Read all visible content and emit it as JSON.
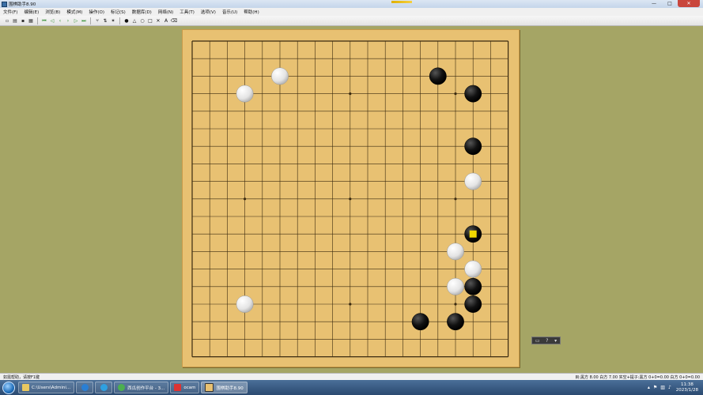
{
  "window": {
    "title": "围棋助手8.90",
    "buttons": {
      "minimize": "—",
      "maximize": "□",
      "close": "✕"
    }
  },
  "menu": [
    "文件(F)",
    "编辑(E)",
    "浏览(B)",
    "模式(M)",
    "操作(O)",
    "标记(S)",
    "数据库(D)",
    "网络(N)",
    "工具(T)",
    "选项(V)",
    "音乐(U)",
    "帮助(H)"
  ],
  "toolbar": [
    {
      "icon": "new-icon",
      "glyph": "▫"
    },
    {
      "icon": "open-icon",
      "glyph": "▤"
    },
    {
      "icon": "save-icon",
      "glyph": "▪"
    },
    {
      "icon": "print-icon",
      "glyph": "▦"
    },
    {
      "icon": "sep"
    },
    {
      "icon": "go-first-icon",
      "glyph": "⏮",
      "c": "green"
    },
    {
      "icon": "step-back-fast-icon",
      "glyph": "◁",
      "c": "green"
    },
    {
      "icon": "step-back-icon",
      "glyph": "‹",
      "c": "green"
    },
    {
      "icon": "step-forward-icon",
      "glyph": "›",
      "c": "green"
    },
    {
      "icon": "step-forward-fast-icon",
      "glyph": "▷",
      "c": "green"
    },
    {
      "icon": "go-last-icon",
      "glyph": "⏭",
      "c": "green"
    },
    {
      "icon": "sep"
    },
    {
      "icon": "variation-icon",
      "glyph": "⑂",
      "c": "dark"
    },
    {
      "icon": "branch-icon",
      "glyph": "⇅",
      "c": "dark"
    },
    {
      "icon": "mark-icon",
      "glyph": "✶",
      "c": "dark"
    },
    {
      "icon": "sep"
    },
    {
      "icon": "stone-black-icon",
      "glyph": "●",
      "c": "dark"
    },
    {
      "icon": "triangle-icon",
      "glyph": "△",
      "c": "dark"
    },
    {
      "icon": "circle-icon",
      "glyph": "○",
      "c": "dark"
    },
    {
      "icon": "square-icon",
      "glyph": "□",
      "c": "dark"
    },
    {
      "icon": "cross-icon",
      "glyph": "✕",
      "c": "dark"
    },
    {
      "icon": "label-icon",
      "glyph": "A",
      "c": "dark"
    },
    {
      "icon": "eraser-icon",
      "glyph": "⌫",
      "c": "dark"
    }
  ],
  "board": {
    "size": 19,
    "black_stones": [
      [
        14,
        2
      ],
      [
        16,
        3
      ],
      [
        16,
        6
      ],
      [
        16,
        11
      ],
      [
        16,
        14
      ],
      [
        16,
        15
      ],
      [
        13,
        16
      ],
      [
        15,
        16
      ]
    ],
    "white_stones": [
      [
        5,
        2
      ],
      [
        3,
        3
      ],
      [
        16,
        8
      ],
      [
        15,
        12
      ],
      [
        16,
        13
      ],
      [
        15,
        14
      ],
      [
        3,
        15
      ]
    ],
    "last_move": [
      16,
      11
    ],
    "colors": {
      "board": "#e8c172",
      "line": "#3a2a10",
      "last_marker": "#f0d800"
    }
  },
  "widget": {
    "help_glyph": "?",
    "menu_glyph": "▾"
  },
  "status": {
    "left": "如需帮助，请按F1键",
    "right": "目:黑方 8.00 白方 7.00  实空+提子:黑方 0+0=0.00 白方 0+0=0.00"
  },
  "taskbar": {
    "items": [
      {
        "label": "C:\\Users\\Admini...",
        "icon": "folder-icon"
      },
      {
        "label": "",
        "icon": "ie-icon"
      },
      {
        "label": "",
        "icon": "browser-icon"
      },
      {
        "label": "西瓜创作平台 - 3...",
        "icon": "chrome-icon"
      },
      {
        "label": "ocam",
        "icon": "ocam-icon"
      },
      {
        "label": "围棋助手8.90",
        "icon": "go-app-icon",
        "active": true
      }
    ],
    "clock_time": "11:38",
    "clock_date": "2023/1/28"
  }
}
